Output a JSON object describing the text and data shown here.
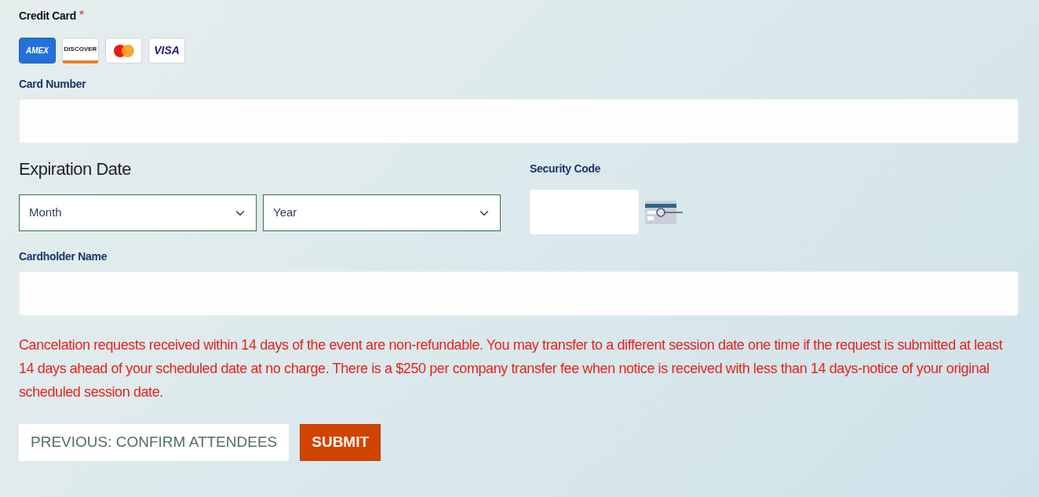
{
  "credit_card": {
    "label": "Credit Card",
    "required_mark": "*"
  },
  "cards": [
    {
      "kind": "amex",
      "label": "AMEX"
    },
    {
      "kind": "discover",
      "label": "DISCOVER"
    },
    {
      "kind": "mastercard"
    },
    {
      "kind": "visa",
      "label": "VISA"
    }
  ],
  "card_number": {
    "label": "Card Number"
  },
  "expiration": {
    "label": "Expiration Date",
    "month": {
      "placeholder": "Month"
    },
    "year": {
      "placeholder": "Year"
    }
  },
  "security_code": {
    "label": "Security Code"
  },
  "cardholder_name": {
    "label": "Cardholder Name"
  },
  "notice": "Cancelation requests received within 14 days of the event are non-refundable. You may transfer to a different session date one time if the request is submitted at least 14 days ahead of your scheduled date at no charge. There is a $250 per company transfer fee when notice is received with less than 14 days-notice of your original scheduled session date.",
  "buttons": [
    {
      "kind": "secondary",
      "label": "PREVIOUS: CONFIRM ATTENDEES"
    },
    {
      "kind": "primary",
      "label": "SUBMIT"
    }
  ]
}
